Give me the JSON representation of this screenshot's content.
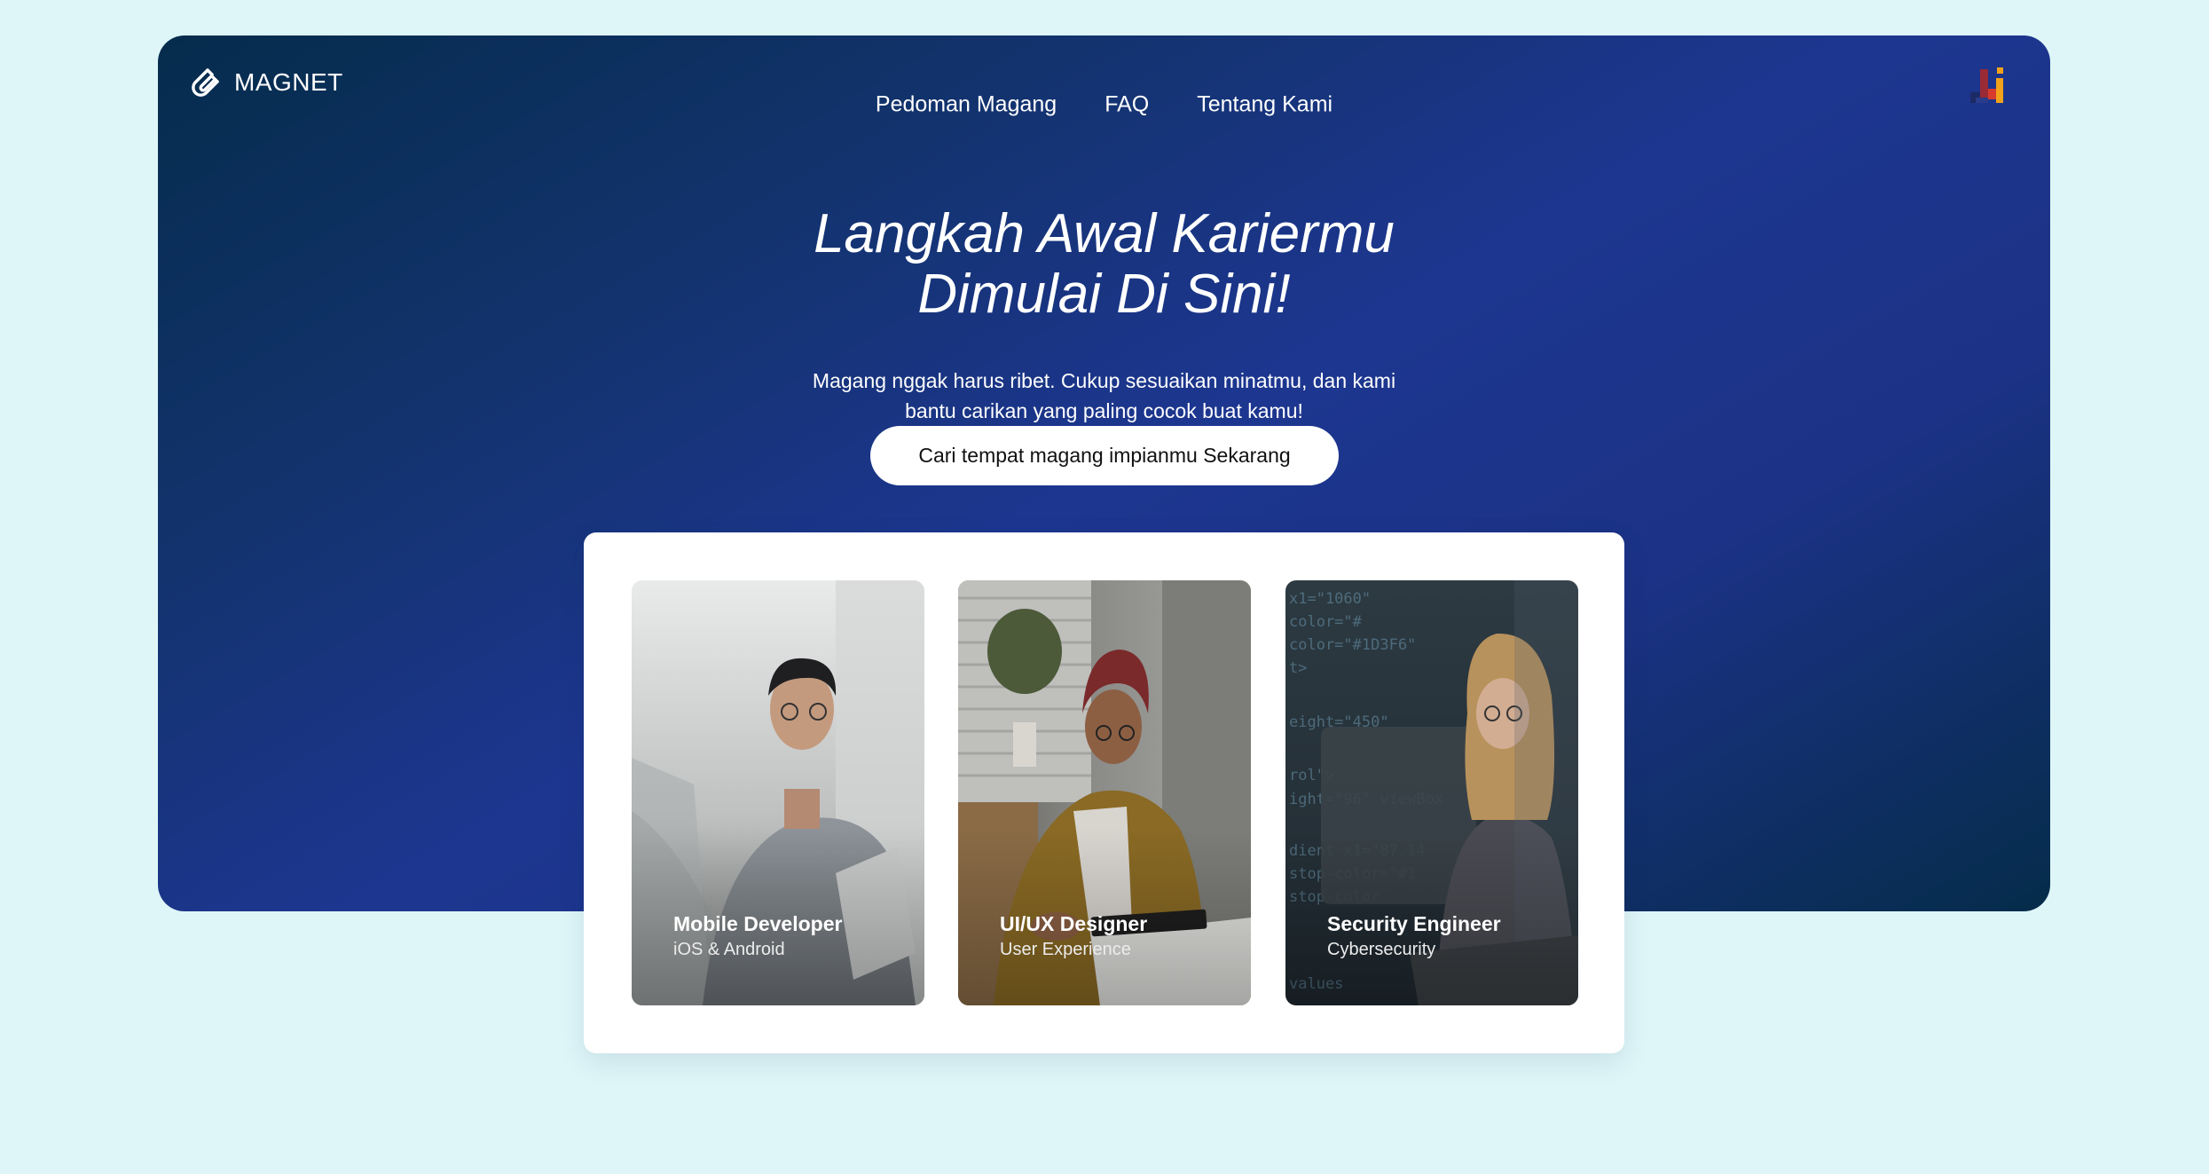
{
  "brand": {
    "name": "MAGNET",
    "logo_icon": "magnet-logo-icon"
  },
  "nav": {
    "items": [
      {
        "label": "Pedoman Magang"
      },
      {
        "label": "FAQ"
      },
      {
        "label": "Tentang Kami"
      }
    ],
    "partner_logo_icon": "partner-logo-icon"
  },
  "hero": {
    "title_line1": "Langkah Awal Kariermu",
    "title_line2": "Dimulai Di Sini!",
    "subtitle_line1": "Magang nggak harus ribet. Cukup sesuaikan minatmu, dan kami",
    "subtitle_line2": "bantu carikan yang paling cocok buat kamu!",
    "cta_label": "Cari tempat magang impianmu Sekarang"
  },
  "cards": [
    {
      "title": "Mobile Developer",
      "subtitle": "iOS & Android"
    },
    {
      "title": "UI/UX Designer",
      "subtitle": "User Experience"
    },
    {
      "title": "Security Engineer",
      "subtitle": "Cybersecurity"
    }
  ],
  "colors": {
    "page_background": "#def6f8",
    "hero_gradient_dark": "#052c4c",
    "hero_gradient_mid": "#1d3690",
    "cta_background": "#ffffff"
  }
}
